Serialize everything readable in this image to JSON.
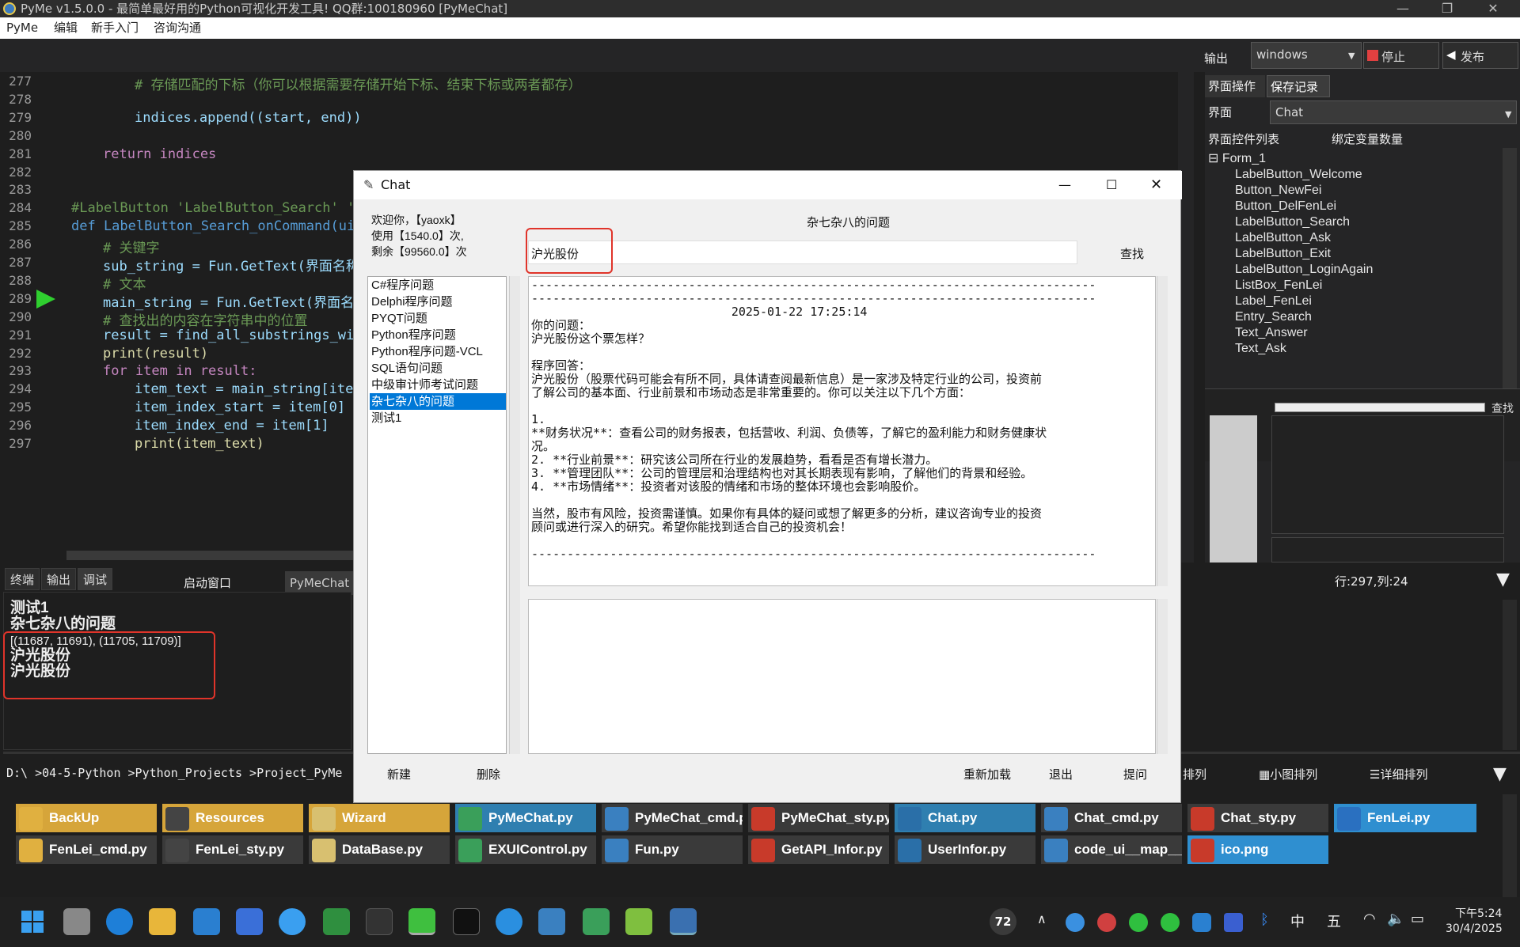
{
  "window": {
    "title": "PyMe v1.5.0.0 - 最简单最好用的Python可视化开发工具! QQ群:100180960    [PyMeChat]"
  },
  "menu": [
    "PyMe",
    "编辑",
    "新手入门",
    "咨询沟通"
  ],
  "toolbar": {
    "output_label": "输出",
    "platform": "windows",
    "stop": "停止",
    "publish": "发布"
  },
  "editor": {
    "lines": [
      {
        "n": "277",
        "text": "    # 存储匹配的下标（你可以根据需要存储开始下标、结束下标或两者都存）"
      },
      {
        "n": "278",
        "text": ""
      },
      {
        "n": "279",
        "text": "    indices.append((start, end))"
      },
      {
        "n": "280",
        "text": ""
      },
      {
        "n": "281",
        "text": "return indices"
      },
      {
        "n": "282",
        "text": ""
      },
      {
        "n": "283",
        "text": ""
      },
      {
        "n": "284",
        "text": "#LabelButton 'LabelButton_Search' 's"
      },
      {
        "n": "285",
        "text": "def LabelButton_Search_onCommand(uiN"
      },
      {
        "n": "286",
        "text": "# 关键字"
      },
      {
        "n": "287",
        "text": "sub_string = Fun.GetText(界面名称"
      },
      {
        "n": "288",
        "text": "# 文本"
      },
      {
        "n": "289",
        "text": "main_string = Fun.GetText(界面名"
      },
      {
        "n": "290",
        "text": "# 查找出的内容在字符串中的位置"
      },
      {
        "n": "291",
        "text": "result = find_all_substrings_wit"
      },
      {
        "n": "292",
        "text": "print(result)"
      },
      {
        "n": "293",
        "text": "for item in result:"
      },
      {
        "n": "294",
        "text": "item_text = main_string[item"
      },
      {
        "n": "295",
        "text": "item_index_start = item[0]"
      },
      {
        "n": "296",
        "text": "item_index_end = item[1]"
      },
      {
        "n": "297",
        "text": "print(item_text)"
      }
    ]
  },
  "right_panel": {
    "tabs": [
      "界面操作",
      "保存记录"
    ],
    "ui_label": "界面",
    "ui_value": "Chat",
    "control_list_label": "界面控件列表",
    "bind_count_label": "绑定变量数量",
    "tree_root": "Form_1",
    "tree_items": [
      "LabelButton_Welcome",
      "Button_NewFei",
      "Button_DelFenLei",
      "LabelButton_Search",
      "LabelButton_Ask",
      "LabelButton_Exit",
      "LabelButton_LoginAgain",
      "ListBox_FenLei",
      "Label_FenLei",
      "Entry_Search",
      "Text_Answer",
      "Text_Ask"
    ],
    "search_label": "查找",
    "cursor_pos": "行:297,列:24"
  },
  "bottom": {
    "tabs": [
      "终端",
      "输出",
      "调试"
    ],
    "launch_label": "启动窗口",
    "launch_tab": "PyMeChat",
    "console": [
      "测试1",
      "杂七杂八的问题",
      "[(11687, 11691), (11705, 11709)]",
      "沪光股份",
      "沪光股份"
    ],
    "path": "D:\\ >04-5-Python >Python_Projects >Project_PyMe",
    "view_list": "排列",
    "view_small": "小图排列",
    "view_detail": "详细排列"
  },
  "files": {
    "row1": [
      {
        "name": "BackUp",
        "color": "#d6a53a"
      },
      {
        "name": "Resources",
        "color": "#d6a53a"
      },
      {
        "name": "Wizard",
        "color": "#d6a53a"
      },
      {
        "name": "PyMeChat.py",
        "color": "#2f7fb0"
      },
      {
        "name": "PyMeChat_cmd.py",
        "color": "#3a3a3a"
      },
      {
        "name": "PyMeChat_sty.py",
        "color": "#3a3a3a"
      },
      {
        "name": "Chat.py",
        "color": "#2f7fb0"
      },
      {
        "name": "Chat_cmd.py",
        "color": "#3a3a3a"
      },
      {
        "name": "Chat_sty.py",
        "color": "#3a3a3a"
      },
      {
        "name": "FenLei.py",
        "color": "#2f8fd0"
      }
    ],
    "row2": [
      {
        "name": "FenLei_cmd.py",
        "color": "#3a3a3a"
      },
      {
        "name": "FenLei_sty.py",
        "color": "#3a3a3a"
      },
      {
        "name": "DataBase.py",
        "color": "#3a3a3a"
      },
      {
        "name": "EXUIControl.py",
        "color": "#3a3a3a"
      },
      {
        "name": "Fun.py",
        "color": "#3a3a3a"
      },
      {
        "name": "GetAPI_Infor.py",
        "color": "#3a3a3a"
      },
      {
        "name": "UserInfor.py",
        "color": "#3a3a3a"
      },
      {
        "name": "code_ui__map__",
        "color": "#3a3a3a"
      },
      {
        "name": "ico.png",
        "color": "#2f8fd0"
      }
    ]
  },
  "dialog": {
    "title": "Chat",
    "welcome": [
      "欢迎你，【yaoxk】",
      "使用【1540.0】次,",
      "剩余【99560.0】次"
    ],
    "category_title": "杂七杂八的问题",
    "search_value": "沪光股份",
    "search_button": "查找",
    "categories": [
      "C#程序问题",
      "Delphi程序问题",
      "PYQT问题",
      "Python程序问题",
      "Python程序问题-VCL",
      "SQL语句问题",
      "中级审计师考试问题",
      "杂七杂八的问题",
      "测试1"
    ],
    "selected_category": 7,
    "answer_lines": [
      "-------------------------------------------------------------------------------",
      "-------------------------------------------------------------------------------",
      "                            2025-01-22 17:25:14",
      "你的问题：",
      "沪光股份这个票怎样？",
      "",
      "程序回答：",
      "沪光股份（股票代码可能会有所不同，具体请查阅最新信息）是一家涉及特定行业的公司，投资前",
      "了解公司的基本面、行业前景和市场动态是非常重要的。你可以关注以下几个方面：",
      "",
      "1.",
      "**财务状况**：查看公司的财务报表，包括营收、利润、负债等，了解它的盈利能力和财务健康状",
      "况。",
      "2. **行业前景**：研究该公司所在行业的发展趋势，看看是否有增长潜力。",
      "3. **管理团队**：公司的管理层和治理结构也对其长期表现有影响，了解他们的背景和经验。",
      "4. **市场情绪**：投资者对该股的情绪和市场的整体环境也会影响股价。",
      "",
      "当然，股市有风险，投资需谨慎。如果你有具体的疑问或想了解更多的分析，建议咨询专业的投资",
      "顾问或进行深入的研究。希望你能找到适合自己的投资机会！",
      "",
      "-------------------------------------------------------------------------------"
    ],
    "buttons": {
      "new": "新建",
      "delete": "删除",
      "reload": "重新加载",
      "exit": "退出",
      "ask": "提问"
    }
  },
  "taskbar": {
    "badge": "72",
    "ime1": "中",
    "ime2": "五",
    "time": "下午5:24",
    "date": "30/4/2025"
  }
}
